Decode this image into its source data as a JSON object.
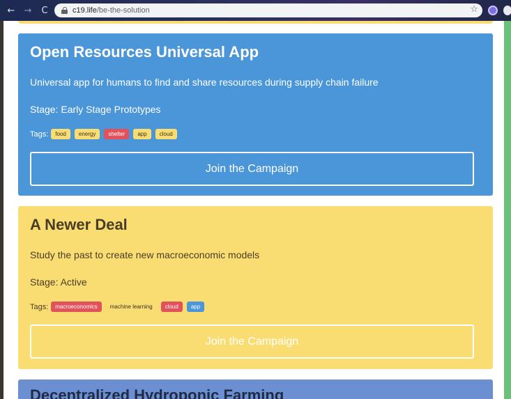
{
  "browser": {
    "back_icon": "←",
    "forward_icon": "→",
    "reload_icon": "C",
    "url_host": "c19.life",
    "url_path": "/be-the-solution",
    "star_icon": "☆"
  },
  "colors": {
    "blue_card": "#4a96d9",
    "yellow_card": "#fadd72",
    "red_tag": "#e2525a",
    "green_strip": "#6cc17a"
  },
  "cards": [
    {
      "title": "Open Resources Universal App",
      "description": "Universal app for humans to find and share resources during supply chain failure",
      "stage": "Stage: Early Stage Prototypes",
      "tags_label": "Tags:",
      "tags": [
        "food",
        "energy",
        "shelter",
        "app",
        "cloud"
      ],
      "join_label": "Join the Campaign"
    },
    {
      "title": "A Newer Deal",
      "description": "Study the past to create new macroeconomic models",
      "stage": "Stage: Active",
      "tags_label": "Tags:",
      "tags": [
        "macroeconomics",
        "machine learning",
        "cloud",
        "app"
      ],
      "join_label": "Join the Campaign"
    },
    {
      "title": "Decentralized Hydroponic Farming"
    }
  ]
}
